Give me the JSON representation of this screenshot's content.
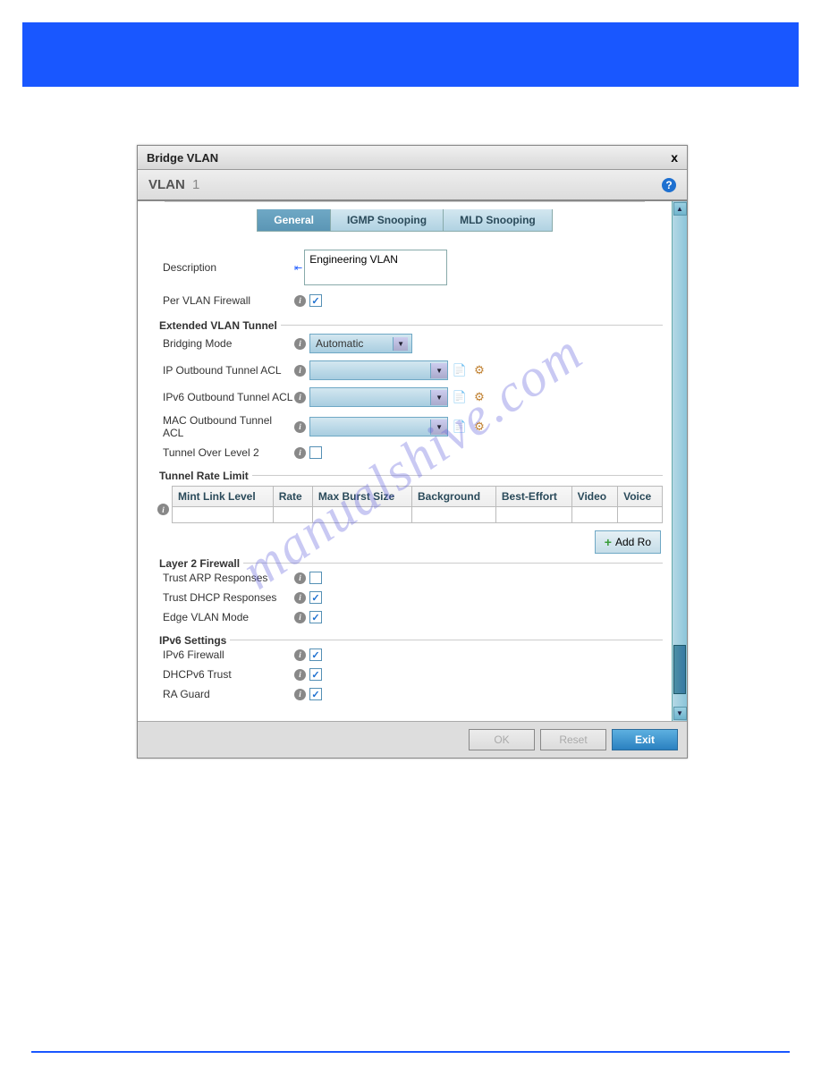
{
  "dialog": {
    "title": "Bridge VLAN",
    "subtitle_label": "VLAN",
    "subtitle_value": "1"
  },
  "tabs": {
    "general": "General",
    "igmp": "IGMP Snooping",
    "mld": "MLD Snooping"
  },
  "form": {
    "description_label": "Description",
    "description_value": "Engineering VLAN",
    "per_vlan_firewall_label": "Per VLAN Firewall"
  },
  "extended": {
    "legend": "Extended VLAN Tunnel",
    "bridging_mode_label": "Bridging Mode",
    "bridging_mode_value": "Automatic",
    "ip_outbound_label": "IP Outbound Tunnel ACL",
    "ipv6_outbound_label": "IPv6 Outbound Tunnel ACL",
    "mac_outbound_label": "MAC Outbound Tunnel ACL",
    "tunnel_over_l2_label": "Tunnel Over Level 2"
  },
  "rate_limit": {
    "legend": "Tunnel Rate Limit",
    "cols": {
      "mint": "Mint Link Level",
      "rate": "Rate",
      "burst": "Max Burst Size",
      "bg": "Background",
      "be": "Best-Effort",
      "video": "Video",
      "voice": "Voice"
    },
    "add_row": "Add Ro"
  },
  "l2fw": {
    "legend": "Layer 2 Firewall",
    "trust_arp": "Trust ARP Responses",
    "trust_dhcp": "Trust DHCP Responses",
    "edge_vlan": "Edge VLAN Mode"
  },
  "ipv6": {
    "legend": "IPv6 Settings",
    "firewall": "IPv6 Firewall",
    "dhcpv6": "DHCPv6 Trust",
    "ra_guard": "RA Guard"
  },
  "footer": {
    "ok": "OK",
    "reset": "Reset",
    "exit": "Exit"
  },
  "watermark": "manualshive.com"
}
